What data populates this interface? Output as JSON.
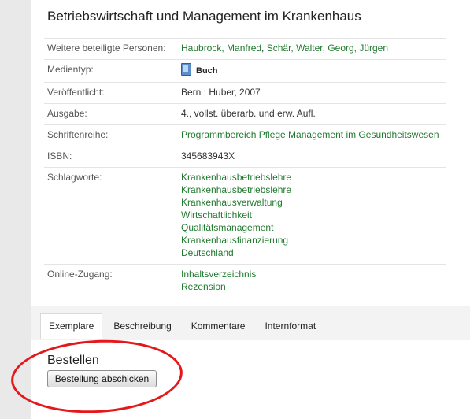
{
  "title": "Betriebswirtschaft und Management im Krankenhaus",
  "details": {
    "persons_label": "Weitere beteiligte Personen:",
    "persons": [
      "Haubrock, Manfred",
      "Schär, Walter",
      "Georg, Jürgen"
    ],
    "media_label": "Medientyp:",
    "media_icon": "book-icon",
    "media_value": "Buch",
    "published_label": "Veröffentlicht:",
    "published_value": "Bern : Huber, 2007",
    "edition_label": "Ausgabe:",
    "edition_value": "4., vollst. überarb. und erw. Aufl.",
    "series_label": "Schriftenreihe:",
    "series_value": "Programmbereich Pflege Management im Gesundheitswesen",
    "isbn_label": "ISBN:",
    "isbn_value": "345683943X",
    "keywords_label": "Schlagworte:",
    "keywords": [
      "Krankenhausbetriebslehre",
      "Krankenhausbetriebslehre",
      "Krankenhausverwaltung",
      "Wirtschaftlichkeit",
      "Qualitätsmanagement",
      "Krankenhausfinanzierung",
      "Deutschland"
    ],
    "online_label": "Online-Zugang:",
    "online_links": [
      "Inhaltsverzeichnis",
      "Rezension"
    ]
  },
  "tabs": [
    "Exemplare",
    "Beschreibung",
    "Kommentare",
    "Internformat"
  ],
  "active_tab": "Exemplare",
  "order": {
    "heading": "Bestellen",
    "button_label": "Bestellung abschicken"
  },
  "colors": {
    "link": "#217a2f",
    "highlight": "#e5171b"
  }
}
